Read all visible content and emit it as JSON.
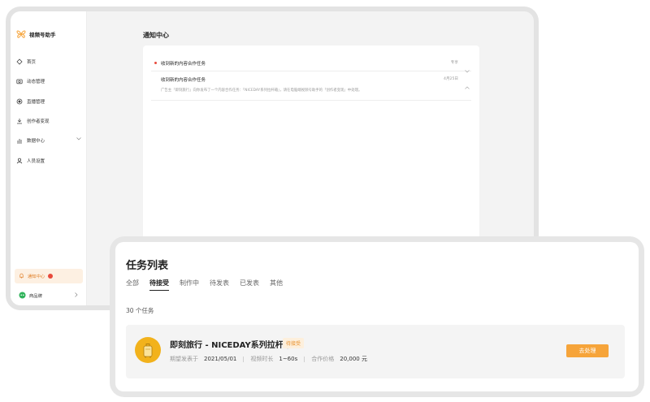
{
  "app": {
    "title": "视频号助手",
    "accent": "#f6a43a",
    "notify_bg": "#fdf0e2"
  },
  "sidebar": {
    "items": [
      {
        "label": "首页",
        "icon": "home-icon"
      },
      {
        "label": "动态管理",
        "icon": "camera-icon"
      },
      {
        "label": "直播管理",
        "icon": "live-icon"
      },
      {
        "label": "创作者变现",
        "icon": "download-icon"
      },
      {
        "label": "数据中心",
        "icon": "chart-icon",
        "expandable": true
      },
      {
        "label": "人员设置",
        "icon": "user-icon"
      }
    ],
    "notify": {
      "label": "通知中心",
      "icon": "bell-icon",
      "badge_color": "#e84a3c"
    },
    "brand": {
      "label": "商品牌",
      "icon": "brand-icon"
    }
  },
  "main": {
    "title": "通知中心",
    "notices": [
      {
        "title": "收到新的内容合作任务",
        "date": "专享",
        "unread": true,
        "expanded": false
      },
      {
        "title": "收到新的内容合作任务",
        "date": "4月25日",
        "unread": false,
        "expanded": true,
        "body": "广告主「即刻旅行」向你发布了一个内容合作任务：「NICEDAY系列拉杆箱」，请在电脑端视频号助手的「创作者变现」中处理。"
      }
    ]
  },
  "tasks": {
    "title": "任务列表",
    "tabs": [
      "全部",
      "待接受",
      "制作中",
      "待发表",
      "已发表",
      "其他"
    ],
    "active_tab": 1,
    "count_label": "30 个任务",
    "item": {
      "name": "即刻旅行 - NICEDAY系列拉杆箱",
      "status": "待接受",
      "publish_label": "期望发表于",
      "publish_value": "2021/05/01",
      "duration_label": "视频时长",
      "duration_value": "1~60s",
      "price_label": "合作价格",
      "price_value": "20,000 元",
      "action_label": "去处理",
      "avatar_icon": "suitcase-icon",
      "avatar_color": "#f2b21c"
    }
  }
}
